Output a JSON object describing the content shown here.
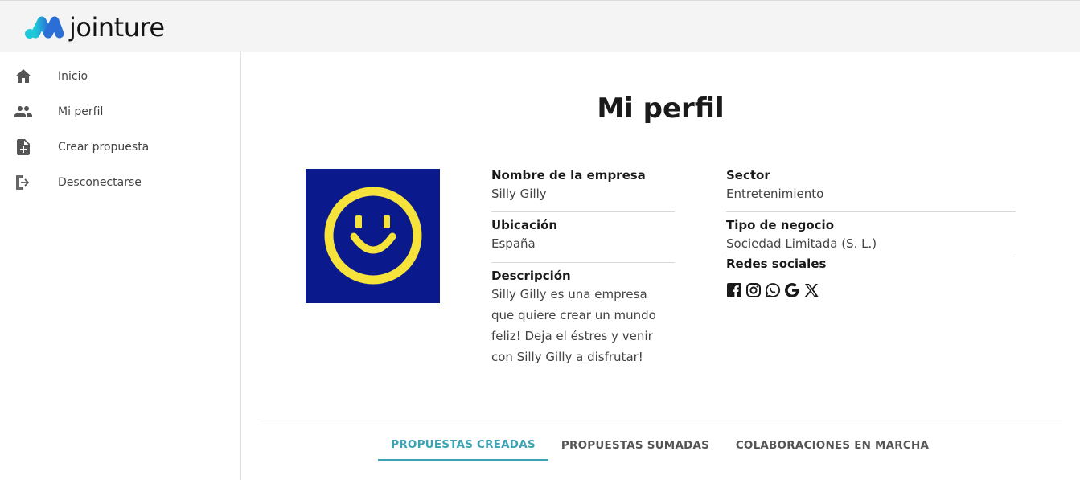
{
  "app": {
    "brand_name": "jointure"
  },
  "sidebar": {
    "items": [
      {
        "label": "Inicio",
        "icon": "home-icon"
      },
      {
        "label": "Mi perfil",
        "icon": "people-icon"
      },
      {
        "label": "Crear propuesta",
        "icon": "note-add-icon"
      },
      {
        "label": "Desconectarse",
        "icon": "logout-icon"
      }
    ]
  },
  "main": {
    "title": "Mi perfil",
    "avatar": {
      "icon": "smiley-logo",
      "background": "#0a1a8c",
      "foreground": "#f5e23a"
    },
    "fields": {
      "company_label": "Nombre de la empresa",
      "company_value": "Silly Gilly",
      "location_label": "Ubicación",
      "location_value": "España",
      "description_label": "Descripción",
      "description_lines": [
        "Silly Gilly es una empresa",
        "que quiere crear un mundo",
        "feliz! Deja el éstres y venir",
        "con Silly Gilly a disfrutar!"
      ],
      "sector_label": "Sector",
      "sector_value": "Entretenimiento",
      "business_type_label": "Tipo de negocio",
      "business_type_value": "Sociedad Limitada (S. L.)",
      "social_label": "Redes sociales"
    },
    "social_icons": [
      "facebook-icon",
      "instagram-icon",
      "whatsapp-icon",
      "google-icon",
      "x-icon"
    ],
    "tabs": [
      {
        "label": "PROPUESTAS CREADAS",
        "active": true
      },
      {
        "label": "PROPUESTAS SUMADAS",
        "active": false
      },
      {
        "label": "COLABORACIONES EN MARCHA",
        "active": false
      }
    ]
  },
  "colors": {
    "accent": "#3ba3b3",
    "brand_gradient": [
      "#1ec8d8",
      "#2b6fd6"
    ]
  }
}
